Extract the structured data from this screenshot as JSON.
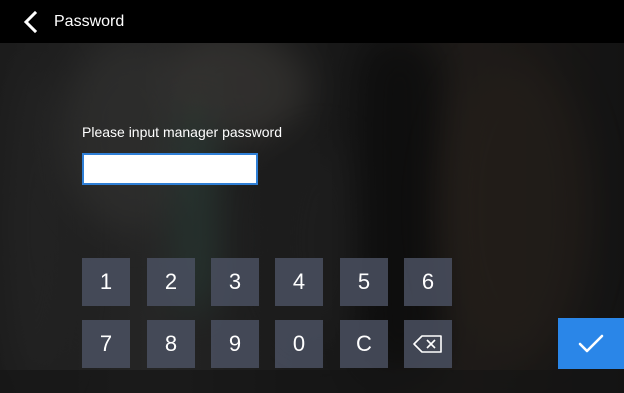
{
  "header": {
    "title": "Password"
  },
  "form": {
    "prompt": "Please input manager password",
    "password_value": ""
  },
  "keypad": {
    "row1": [
      "1",
      "2",
      "3",
      "4",
      "5",
      "6"
    ],
    "row2": [
      "7",
      "8",
      "9",
      "0",
      "C"
    ]
  },
  "icons": {
    "back": "chevron-left-icon",
    "backspace": "backspace-icon",
    "confirm": "checkmark-icon"
  },
  "colors": {
    "topbar": "#000000",
    "key_bg": "#4a5060",
    "accent": "#2a86e8",
    "input_border": "#2f7fd6"
  }
}
